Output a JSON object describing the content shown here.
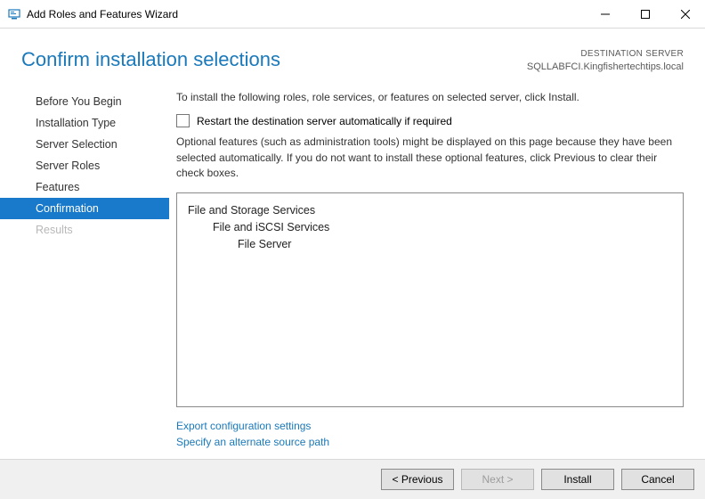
{
  "window": {
    "title": "Add Roles and Features Wizard"
  },
  "header": {
    "page_title": "Confirm installation selections",
    "destination_label": "DESTINATION SERVER",
    "destination_server": "SQLLABFCI.Kingfishertechtips.local"
  },
  "sidebar": {
    "items": [
      {
        "label": "Before You Begin",
        "selected": false,
        "disabled": false
      },
      {
        "label": "Installation Type",
        "selected": false,
        "disabled": false
      },
      {
        "label": "Server Selection",
        "selected": false,
        "disabled": false
      },
      {
        "label": "Server Roles",
        "selected": false,
        "disabled": false
      },
      {
        "label": "Features",
        "selected": false,
        "disabled": false
      },
      {
        "label": "Confirmation",
        "selected": true,
        "disabled": false
      },
      {
        "label": "Results",
        "selected": false,
        "disabled": true
      }
    ]
  },
  "content": {
    "intro": "To install the following roles, role services, or features on selected server, click Install.",
    "restart_checkbox_label": "Restart the destination server automatically if required",
    "restart_checked": false,
    "note": "Optional features (such as administration tools) might be displayed on this page because they have been selected automatically. If you do not want to install these optional features, click Previous to clear their check boxes.",
    "features": [
      {
        "label": "File and Storage Services",
        "level": 1
      },
      {
        "label": "File and iSCSI Services",
        "level": 2
      },
      {
        "label": "File Server",
        "level": 3
      }
    ],
    "links": {
      "export": "Export configuration settings",
      "alt_source": "Specify an alternate source path"
    }
  },
  "footer": {
    "previous": "< Previous",
    "next": "Next >",
    "install": "Install",
    "cancel": "Cancel"
  }
}
